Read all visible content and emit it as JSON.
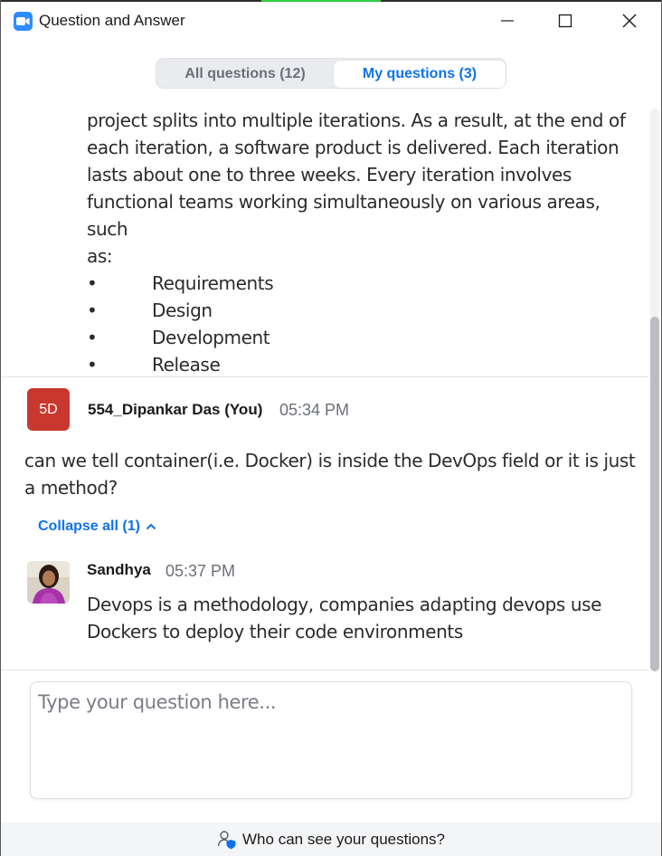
{
  "window": {
    "title": "Question and Answer",
    "accent": "#2d8cff"
  },
  "tabs": [
    {
      "label": "All questions (12)",
      "selected": false
    },
    {
      "label": "My questions (3)",
      "selected": true
    }
  ],
  "previous_answer": {
    "lines": [
      "project splits into multiple iterations. As a result, at the end of",
      "each iteration, a software product is delivered. Each iteration",
      "lasts about one to three weeks. Every iteration involves",
      "functional teams working simultaneously on various areas, such",
      "as:"
    ],
    "bullet_symbol": "•",
    "bullets": [
      "Requirements",
      "Design",
      "Development",
      "Release"
    ]
  },
  "question": {
    "avatar_initials": "5D",
    "avatar_color": "#c9382e",
    "author": "554_Dipankar Das (You)",
    "time": "05:34 PM",
    "text": "can we tell container(i.e. Docker) is inside the DevOps field or it is just a method?",
    "collapse_label": "Collapse all (1)"
  },
  "answer": {
    "author": "Sandhya",
    "time": "05:37 PM",
    "text": "Devops is a methodology, companies adapting devops use Dockers to deploy their code environments"
  },
  "input": {
    "placeholder": "Type your question here..."
  },
  "footer": {
    "label": "Who can see your questions?"
  }
}
